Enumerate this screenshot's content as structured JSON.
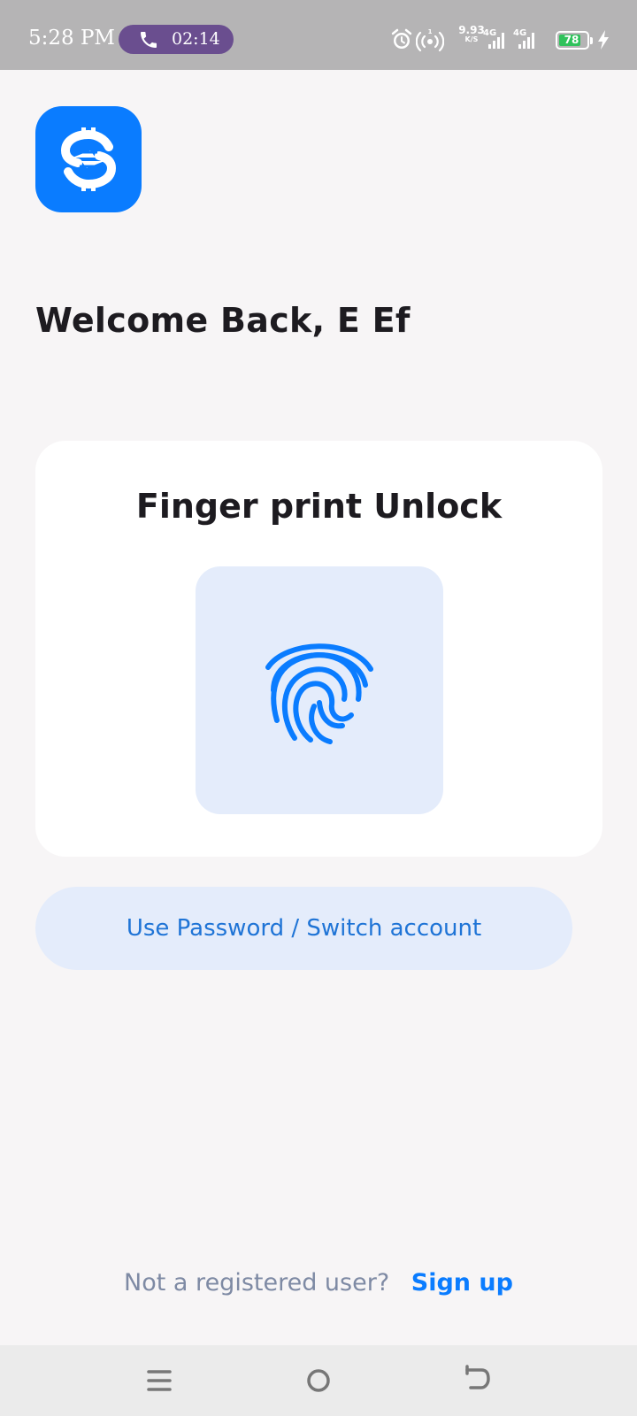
{
  "status_bar": {
    "time": "5:28 PM",
    "call_duration": "02:14",
    "net_speed_value": "9.93",
    "net_speed_unit": "K/S",
    "sim1_label": "4G",
    "sim2_label": "4G",
    "battery_level": "78",
    "icons": [
      "alarm-icon",
      "hotspot-icon",
      "signal-icon",
      "battery-icon",
      "charging-icon"
    ]
  },
  "app": {
    "logo_icon": "currency-exchange-icon",
    "brand_color": "#0a7cff"
  },
  "welcome": {
    "title": "Welcome Back, E Ef"
  },
  "fingerprint_card": {
    "title": "Finger print Unlock",
    "icon": "fingerprint-icon"
  },
  "alt_action": {
    "label": "Use Password / Switch account"
  },
  "signup": {
    "prompt": "Not a registered user?",
    "link_label": "Sign up"
  },
  "nav_bar": {
    "items": [
      "menu-icon",
      "home-icon",
      "back-icon"
    ]
  }
}
